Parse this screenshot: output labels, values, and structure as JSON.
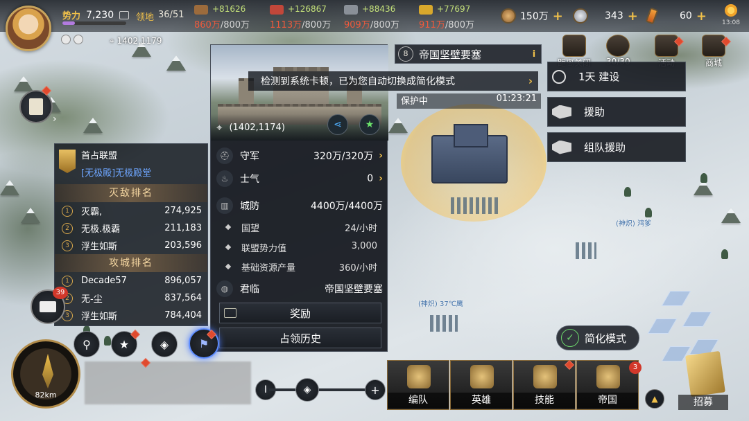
{
  "top": {
    "power_label": "势力",
    "power_value": "7,230",
    "power_progress": 0.2,
    "territory_label": "领地",
    "territory_value": "36/51",
    "coords": "1402,1179"
  },
  "resources": [
    {
      "icon": "wood-icon",
      "color": "#9c6b3c",
      "gain": "+81626",
      "current": "860万",
      "max": "/800万"
    },
    {
      "icon": "meat-icon",
      "color": "#c2473a",
      "gain": "+126867",
      "current": "1113万",
      "max": "/800万"
    },
    {
      "icon": "iron-icon",
      "color": "#8a9098",
      "gain": "+88436",
      "current": "909万",
      "max": "/800万"
    },
    {
      "icon": "grain-icon",
      "color": "#d8a82c",
      "gain": "+77697",
      "current": "911万",
      "max": "/800万"
    }
  ],
  "currencies": [
    {
      "icon": "copper-coin-icon",
      "value": "150万"
    },
    {
      "icon": "silver-coin-icon",
      "value": "343"
    },
    {
      "icon": "gem-icon",
      "value": "60"
    }
  ],
  "clock": {
    "time": "13:08"
  },
  "notice": {
    "text": "检测到系统卡顿，已为您自动切换成简化模式"
  },
  "location": {
    "level": "8",
    "title": "帝国坚壁要塞",
    "coords": "(1402,1174)",
    "protection_label": "保护中",
    "protection_time": "01:23:21"
  },
  "stats": [
    {
      "icon": "helmet-icon",
      "name": "守军",
      "value": "320万/320万",
      "chevron": "›"
    },
    {
      "icon": "flame-icon",
      "name": "士气",
      "value": "0",
      "chevron": "›"
    },
    {
      "icon": "wall-icon",
      "name": "城防",
      "value": "4400万/4400万",
      "chevron": ""
    }
  ],
  "details": [
    {
      "name": "国望",
      "value": "24/小时"
    },
    {
      "name": "联盟势力值",
      "value": "3,000"
    },
    {
      "name": "基础资源产量",
      "value": "360/小时"
    }
  ],
  "ruler": {
    "name": "君临",
    "value": "帝国坚壁要塞"
  },
  "buttons": {
    "reward": "奖励",
    "history": "占领历史"
  },
  "actions": [
    {
      "label": "1天 建设"
    },
    {
      "label": "援助"
    },
    {
      "label": "组队援助"
    }
  ],
  "top_right_icons": [
    {
      "label": "距离关闭",
      "value": "30/30"
    },
    {
      "label": "活动"
    },
    {
      "label": "商城"
    }
  ],
  "alliance": {
    "title": "首占联盟",
    "name": "[无极殿]无极殿堂",
    "kill_rank_label": "灭敌排名",
    "kill_rank": [
      {
        "rank": "1",
        "name": "灭霸,",
        "score": "274,925"
      },
      {
        "rank": "2",
        "name": "无极.极霸",
        "score": "211,183"
      },
      {
        "rank": "3",
        "name": "浮生如斯",
        "score": "203,596"
      }
    ],
    "siege_rank_label": "攻城排名",
    "siege_rank": [
      {
        "rank": "1",
        "name": "Decade57",
        "score": "896,057"
      },
      {
        "rank": "2",
        "name": "无-尘",
        "score": "837,564"
      },
      {
        "rank": "3",
        "name": "浮生如斯",
        "score": "784,404"
      }
    ]
  },
  "mail": {
    "count": "39"
  },
  "compass": {
    "distance": "82km"
  },
  "simplify_mode": "简化模式",
  "tabs": [
    {
      "label": "编队"
    },
    {
      "label": "英雄"
    },
    {
      "label": "技能"
    },
    {
      "label": "帝国",
      "badge": "3"
    }
  ],
  "recruit": "招募",
  "map_labels": [
    {
      "text": "(神炽) 37℃鹰"
    },
    {
      "text": "(神炽) 鸿爹"
    }
  ]
}
